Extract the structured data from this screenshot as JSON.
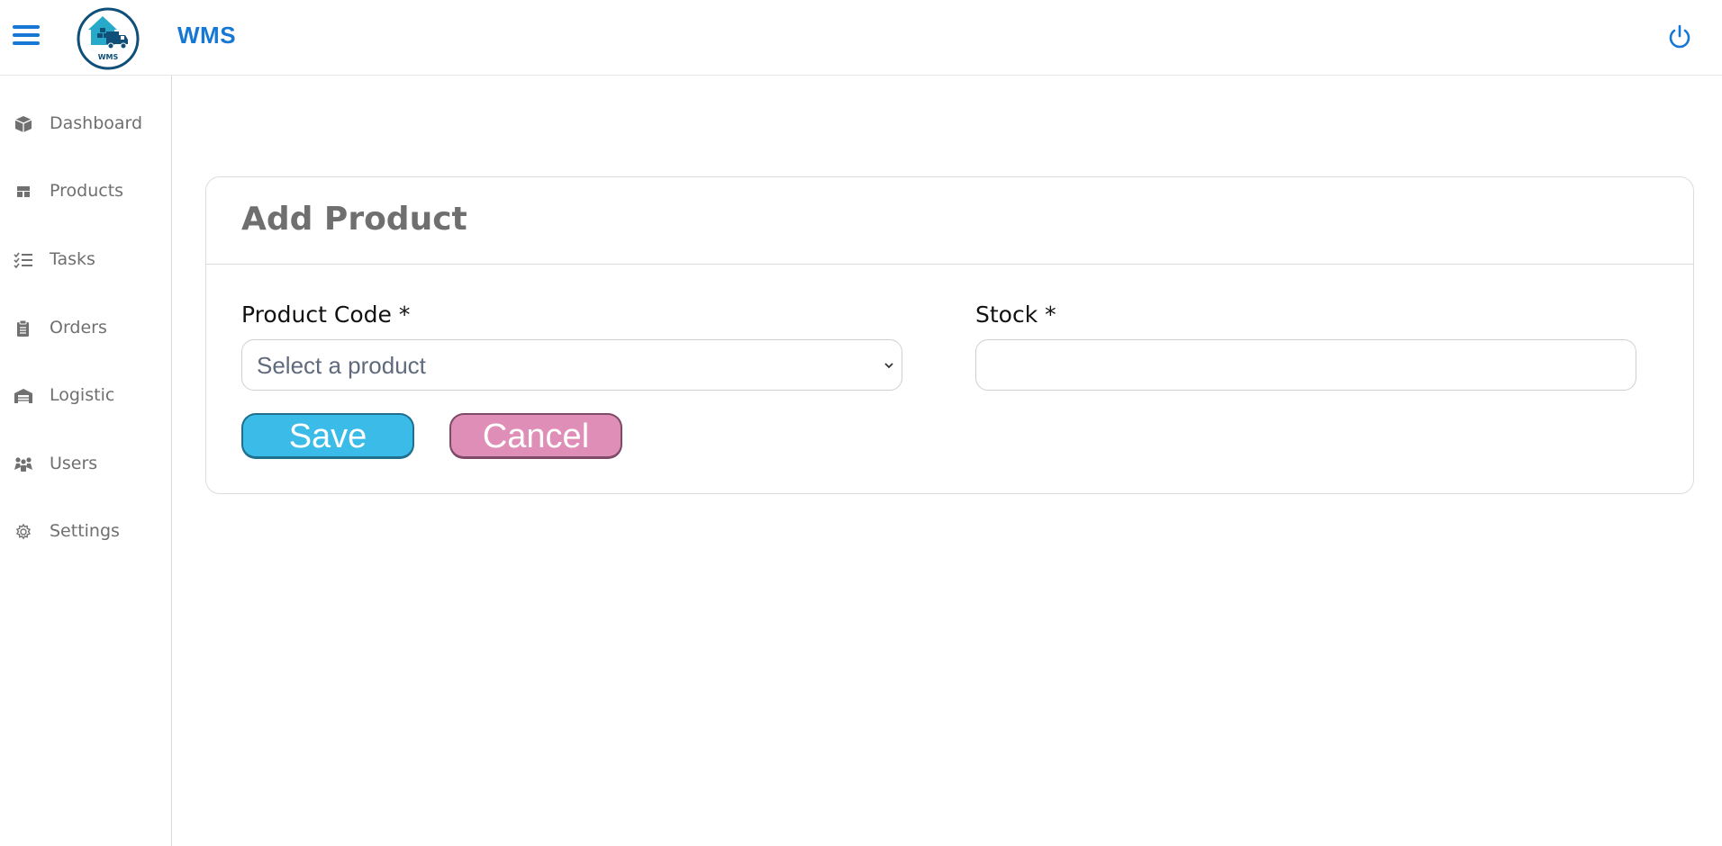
{
  "app": {
    "brand": "WMS",
    "logo_text": "WMS",
    "accent_color": "#1678d4"
  },
  "icons": {
    "menu": "hamburger-menu-icon",
    "power": "power-icon"
  },
  "sidebar": {
    "items": [
      {
        "label": "Dashboard",
        "icon": "cube-icon"
      },
      {
        "label": "Products",
        "icon": "layout-icon"
      },
      {
        "label": "Tasks",
        "icon": "checklist-icon"
      },
      {
        "label": "Orders",
        "icon": "clipboard-icon"
      },
      {
        "label": "Logistic",
        "icon": "warehouse-icon"
      },
      {
        "label": "Users",
        "icon": "users-icon"
      },
      {
        "label": "Settings",
        "icon": "gear-icon"
      }
    ]
  },
  "form": {
    "title": "Add Product",
    "product_code_label": "Product Code *",
    "product_select_value": "Select a product",
    "stock_label": "Stock *",
    "stock_value": "",
    "save_label": "Save",
    "cancel_label": "Cancel",
    "save_color": "#3bbbe7",
    "cancel_color": "#df8fb7"
  }
}
